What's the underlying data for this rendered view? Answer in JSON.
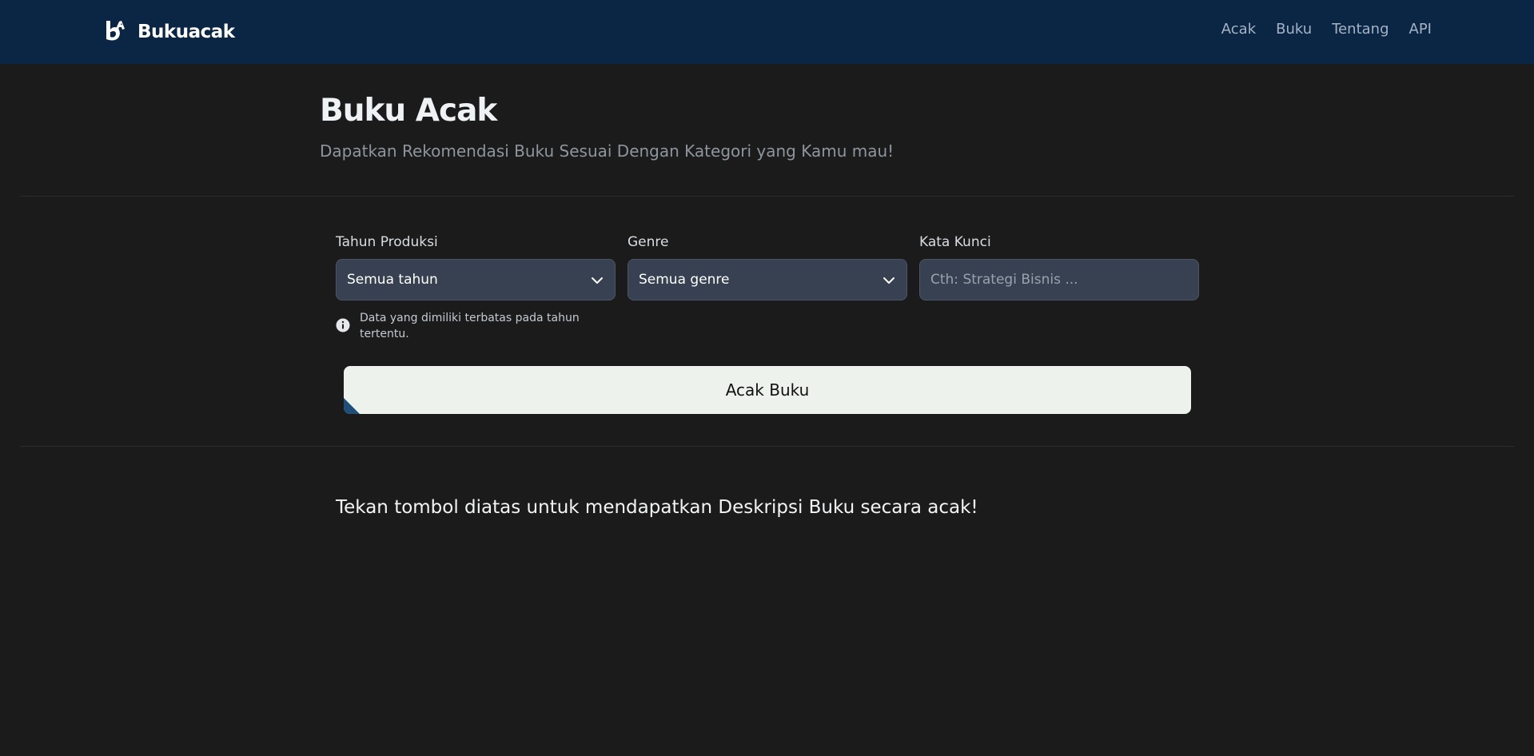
{
  "navbar": {
    "brand_name": "Bukuacak",
    "brand_icon": "book-logo-icon",
    "links": [
      "Acak",
      "Buku",
      "Tentang",
      "API"
    ]
  },
  "hero": {
    "title": "Buku Acak",
    "subtitle": "Dapatkan Rekomendasi Buku Sesuai Dengan Kategori yang Kamu mau!"
  },
  "form": {
    "year": {
      "label": "Tahun Produksi",
      "value": "Semua tahun"
    },
    "genre": {
      "label": "Genre",
      "value": "Semua genre"
    },
    "keyword": {
      "label": "Kata Kunci",
      "placeholder": "Cth: Strategi Bisnis ..."
    },
    "hint": "Data yang dimiliki terbatas pada tahun tertentu.",
    "submit_label": "Acak Buku"
  },
  "result": {
    "prompt": "Tekan tombol diatas untuk mendapatkan Deskripsi Buku secara acak!"
  },
  "colors": {
    "navbar_bg": "#0b2545",
    "page_bg": "#1b1b1b",
    "input_bg": "#374151",
    "button_bg": "#edf2ec"
  }
}
